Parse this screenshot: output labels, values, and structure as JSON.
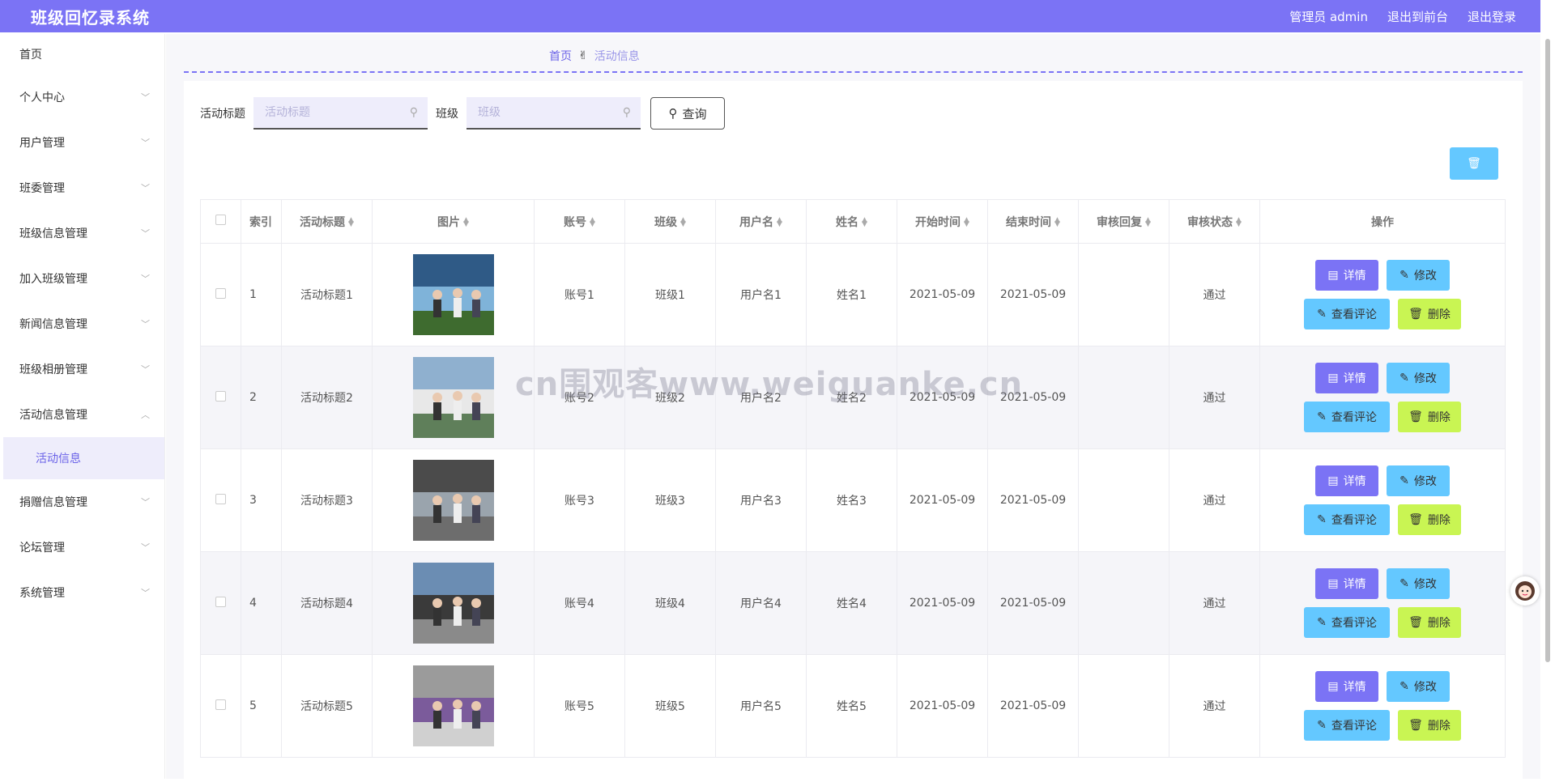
{
  "header": {
    "title": "班级回忆录系统",
    "admin_label": "管理员 admin",
    "frontend_label": "退出到前台",
    "logout_label": "退出登录",
    "accent": "#7b73f5"
  },
  "sidebar": {
    "items": [
      {
        "label": "首页"
      },
      {
        "label": "个人中心"
      },
      {
        "label": "用户管理"
      },
      {
        "label": "班委管理"
      },
      {
        "label": "班级信息管理"
      },
      {
        "label": "加入班级管理"
      },
      {
        "label": "新闻信息管理"
      },
      {
        "label": "班级相册管理"
      },
      {
        "label": "活动信息管理"
      },
      {
        "label": "活动信息"
      },
      {
        "label": "捐赠信息管理"
      },
      {
        "label": "论坛管理"
      },
      {
        "label": "系统管理"
      }
    ]
  },
  "breadcrumb": {
    "home": "首页",
    "current": "活动信息"
  },
  "search": {
    "title_label": "活动标题",
    "title_placeholder": "活动标题",
    "class_label": "班级",
    "class_placeholder": "班级",
    "query_label": "查询"
  },
  "table": {
    "headers": [
      "索引",
      "活动标题",
      "图片",
      "账号",
      "班级",
      "用户名",
      "姓名",
      "开始时间",
      "结束时间",
      "审核回复",
      "审核状态",
      "操作"
    ],
    "rows": [
      {
        "index": "1",
        "title": "活动标题1",
        "account": "账号1",
        "class": "班级1",
        "username": "用户名1",
        "name": "姓名1",
        "start": "2021-05-09",
        "end": "2021-05-09",
        "reply": "",
        "status": "通过"
      },
      {
        "index": "2",
        "title": "活动标题2",
        "account": "账号2",
        "class": "班级2",
        "username": "用户名2",
        "name": "姓名2",
        "start": "2021-05-09",
        "end": "2021-05-09",
        "reply": "",
        "status": "通过"
      },
      {
        "index": "3",
        "title": "活动标题3",
        "account": "账号3",
        "class": "班级3",
        "username": "用户名3",
        "name": "姓名3",
        "start": "2021-05-09",
        "end": "2021-05-09",
        "reply": "",
        "status": "通过"
      },
      {
        "index": "4",
        "title": "活动标题4",
        "account": "账号4",
        "class": "班级4",
        "username": "用户名4",
        "name": "姓名4",
        "start": "2021-05-09",
        "end": "2021-05-09",
        "reply": "",
        "status": "通过"
      },
      {
        "index": "5",
        "title": "活动标题5",
        "account": "账号5",
        "class": "班级5",
        "username": "用户名5",
        "name": "姓名5",
        "start": "2021-05-09",
        "end": "2021-05-09",
        "reply": "",
        "status": "通过"
      }
    ],
    "actions": {
      "detail": "详情",
      "edit": "修改",
      "comment": "查看评论",
      "delete": "删除"
    }
  },
  "watermark": "cn围观客www.weiguanke.cn"
}
